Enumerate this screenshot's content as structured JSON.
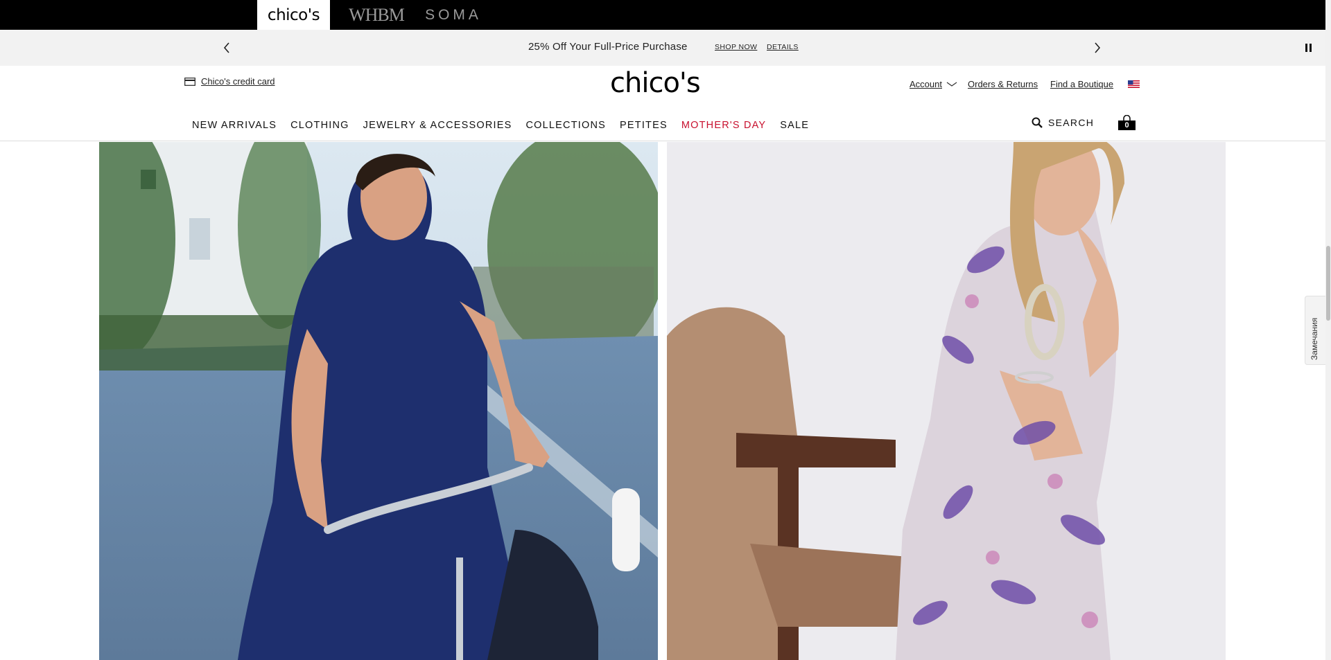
{
  "brands": {
    "chicos": "chico's",
    "whbm": "WHBM",
    "soma": "SOMA"
  },
  "promo": {
    "text": "25% Off Your Full-Price Purchase",
    "shop_now": "SHOP NOW",
    "details": "DETAILS",
    "prev_icon": "chevron-left-icon",
    "next_icon": "chevron-right-icon",
    "pause_icon": "pause-icon"
  },
  "header": {
    "credit_card_label": "Chico's credit card",
    "logo": "chico's",
    "account_label": "Account",
    "orders_label": "Orders & Returns",
    "boutique_label": "Find a Boutique",
    "search_label": "SEARCH",
    "cart_count": "0"
  },
  "nav": {
    "items": [
      "NEW ARRIVALS",
      "CLOTHING",
      "JEWELRY & ACCESSORIES",
      "COLLECTIONS",
      "PETITES",
      "MOTHER'S DAY",
      "SALE"
    ]
  },
  "feedback": {
    "label": "Замечания"
  },
  "colors": {
    "accent_red": "#c8102e",
    "brand_bar": "#000000",
    "promo_bg": "#f2f2f2"
  }
}
